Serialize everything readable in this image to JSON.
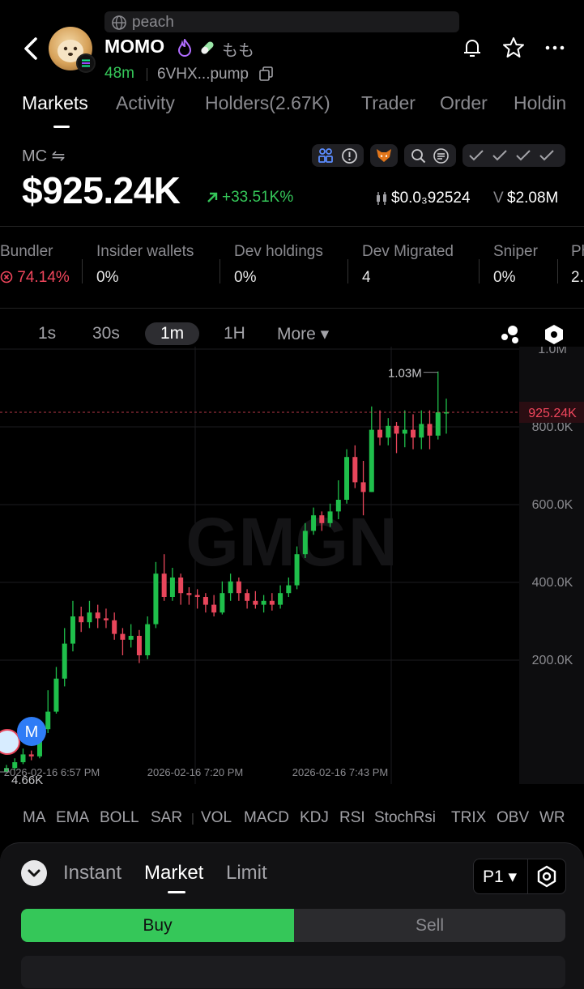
{
  "browser": {
    "url": "peach"
  },
  "token": {
    "name": "MOMO",
    "alt_name": "もも",
    "age": "48m",
    "address": "6VHX...pump"
  },
  "tabs": [
    "Markets",
    "Activity",
    "Holders(2.67K)",
    "Trader",
    "Order",
    "Holdin"
  ],
  "market_cap": {
    "label": "MC ⇋",
    "value": "$925.24K",
    "change": "+33.51K%",
    "price": "$0.0₃92524",
    "volume_prefix": "V",
    "volume": "$2.08M"
  },
  "stats": [
    {
      "label": "Bundler",
      "value": "74.14%",
      "alert": true
    },
    {
      "label": "Insider wallets",
      "value": "0%"
    },
    {
      "label": "Dev holdings",
      "value": "0%"
    },
    {
      "label": "Dev Migrated",
      "value": "4"
    },
    {
      "label": "Sniper",
      "value": "0%"
    },
    {
      "label": "Ph",
      "value": "2."
    }
  ],
  "timeframes": [
    "1s",
    "30s",
    "1m",
    "1H",
    "More ▾"
  ],
  "active_timeframe": "1m",
  "chart_data": {
    "type": "candlestick",
    "y_ticks": [
      "1.0M",
      "800.0K",
      "600.0K",
      "400.0K",
      "200.0K"
    ],
    "current_label": "925.24K",
    "high_label": "1.03M",
    "low_label": "4.66K",
    "marker_label": "M",
    "x_ticks": [
      "2026-02-16 6:57 PM",
      "2026-02-16 7:20 PM",
      "2026-02-16 7:43 PM"
    ],
    "watermark": "GMGN",
    "up_color": "#1fbf4b",
    "down_color": "#e8465b",
    "candles": [
      {
        "o": 0,
        "c": 10,
        "h": 18,
        "l": 0
      },
      {
        "o": 10,
        "c": 25,
        "h": 35,
        "l": 5
      },
      {
        "o": 25,
        "c": 45,
        "h": 60,
        "l": 20
      },
      {
        "o": 45,
        "c": 40,
        "h": 55,
        "l": 30
      },
      {
        "o": 40,
        "c": 110,
        "h": 130,
        "l": 35
      },
      {
        "o": 110,
        "c": 155,
        "h": 210,
        "l": 100
      },
      {
        "o": 155,
        "c": 240,
        "h": 270,
        "l": 150
      },
      {
        "o": 240,
        "c": 330,
        "h": 370,
        "l": 220
      },
      {
        "o": 330,
        "c": 400,
        "h": 440,
        "l": 310
      },
      {
        "o": 400,
        "c": 385,
        "h": 425,
        "l": 360
      },
      {
        "o": 385,
        "c": 410,
        "h": 440,
        "l": 370
      },
      {
        "o": 410,
        "c": 395,
        "h": 430,
        "l": 370
      },
      {
        "o": 395,
        "c": 390,
        "h": 420,
        "l": 370
      },
      {
        "o": 390,
        "c": 355,
        "h": 410,
        "l": 340
      },
      {
        "o": 355,
        "c": 340,
        "h": 370,
        "l": 300
      },
      {
        "o": 340,
        "c": 350,
        "h": 380,
        "l": 320
      },
      {
        "o": 350,
        "c": 300,
        "h": 365,
        "l": 280
      },
      {
        "o": 300,
        "c": 380,
        "h": 400,
        "l": 290
      },
      {
        "o": 380,
        "c": 510,
        "h": 540,
        "l": 370
      },
      {
        "o": 510,
        "c": 450,
        "h": 560,
        "l": 440
      },
      {
        "o": 450,
        "c": 500,
        "h": 525,
        "l": 440
      },
      {
        "o": 500,
        "c": 460,
        "h": 510,
        "l": 430
      },
      {
        "o": 460,
        "c": 455,
        "h": 475,
        "l": 430
      },
      {
        "o": 455,
        "c": 450,
        "h": 470,
        "l": 420
      },
      {
        "o": 450,
        "c": 430,
        "h": 460,
        "l": 410
      },
      {
        "o": 430,
        "c": 410,
        "h": 455,
        "l": 400
      },
      {
        "o": 410,
        "c": 460,
        "h": 490,
        "l": 405
      },
      {
        "o": 460,
        "c": 490,
        "h": 510,
        "l": 440
      },
      {
        "o": 490,
        "c": 460,
        "h": 500,
        "l": 440
      },
      {
        "o": 460,
        "c": 440,
        "h": 470,
        "l": 420
      },
      {
        "o": 440,
        "c": 430,
        "h": 465,
        "l": 420
      },
      {
        "o": 430,
        "c": 440,
        "h": 455,
        "l": 410
      },
      {
        "o": 440,
        "c": 430,
        "h": 460,
        "l": 415
      },
      {
        "o": 430,
        "c": 460,
        "h": 480,
        "l": 420
      },
      {
        "o": 460,
        "c": 480,
        "h": 500,
        "l": 450
      },
      {
        "o": 480,
        "c": 560,
        "h": 580,
        "l": 470
      },
      {
        "o": 560,
        "c": 620,
        "h": 640,
        "l": 550
      },
      {
        "o": 620,
        "c": 660,
        "h": 680,
        "l": 610
      },
      {
        "o": 660,
        "c": 640,
        "h": 670,
        "l": 620
      },
      {
        "o": 640,
        "c": 670,
        "h": 690,
        "l": 630
      },
      {
        "o": 670,
        "c": 700,
        "h": 750,
        "l": 650
      },
      {
        "o": 700,
        "c": 810,
        "h": 830,
        "l": 690
      },
      {
        "o": 810,
        "c": 745,
        "h": 840,
        "l": 730
      },
      {
        "o": 745,
        "c": 720,
        "h": 800,
        "l": 660
      },
      {
        "o": 720,
        "c": 880,
        "h": 940,
        "l": 720
      },
      {
        "o": 880,
        "c": 860,
        "h": 930,
        "l": 840
      },
      {
        "o": 860,
        "c": 890,
        "h": 910,
        "l": 840
      },
      {
        "o": 890,
        "c": 870,
        "h": 900,
        "l": 820
      },
      {
        "o": 870,
        "c": 880,
        "h": 930,
        "l": 835
      },
      {
        "o": 880,
        "c": 860,
        "h": 920,
        "l": 830
      },
      {
        "o": 860,
        "c": 895,
        "h": 930,
        "l": 830
      },
      {
        "o": 895,
        "c": 865,
        "h": 930,
        "l": 830
      },
      {
        "o": 865,
        "c": 925,
        "h": 1030,
        "l": 855
      },
      {
        "o": 925,
        "c": 925,
        "h": 960,
        "l": 870
      }
    ]
  },
  "indicators": [
    "MA",
    "EMA",
    "BOLL",
    "SAR",
    "|",
    "VOL",
    "MACD",
    "KDJ",
    "RSI",
    "StochRsi",
    "TRIX",
    "OBV",
    "WR"
  ],
  "trade": {
    "modes": [
      "Instant",
      "Market",
      "Limit"
    ],
    "active_mode": "Market",
    "preset": "P1 ▾",
    "buy_label": "Buy",
    "sell_label": "Sell"
  }
}
